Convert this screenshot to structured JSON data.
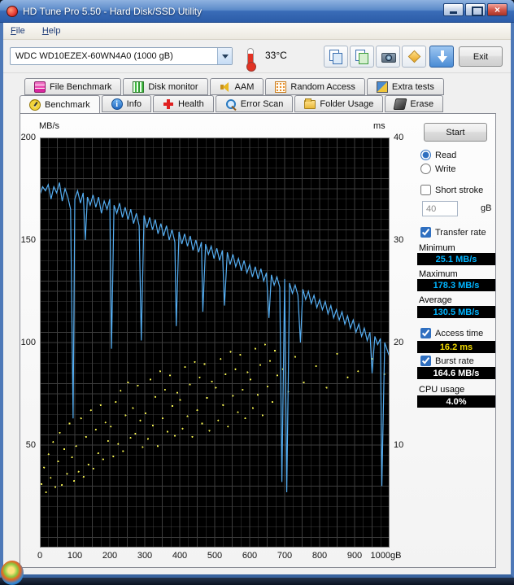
{
  "window": {
    "title": "HD Tune Pro 5.50 - Hard Disk/SSD Utility",
    "close_glyph": "×"
  },
  "menu": {
    "file": "File",
    "help": "Help"
  },
  "toolbar": {
    "drive": "WDC WD10EZEX-60WN4A0 (1000 gB)",
    "temperature": "33°C",
    "exit": "Exit"
  },
  "tabs_row1": [
    {
      "label": "File Benchmark",
      "icon": "file-benchmark-icon"
    },
    {
      "label": "Disk monitor",
      "icon": "disk-monitor-icon"
    },
    {
      "label": "AAM",
      "icon": "aam-icon"
    },
    {
      "label": "Random Access",
      "icon": "random-access-icon"
    },
    {
      "label": "Extra tests",
      "icon": "extra-tests-icon"
    }
  ],
  "tabs_row2": [
    {
      "label": "Benchmark",
      "icon": "benchmark-icon",
      "active": true
    },
    {
      "label": "Info",
      "icon": "info-icon",
      "active": false
    },
    {
      "label": "Health",
      "icon": "health-icon",
      "active": false
    },
    {
      "label": "Error Scan",
      "icon": "error-scan-icon",
      "active": false
    },
    {
      "label": "Folder Usage",
      "icon": "folder-usage-icon",
      "active": false
    },
    {
      "label": "Erase",
      "icon": "erase-icon",
      "active": false
    }
  ],
  "controls": {
    "start": "Start",
    "read": "Read",
    "write": "Write",
    "short_stroke": "Short stroke",
    "short_stroke_value": "40",
    "gb_unit": "gB",
    "transfer_rate": "Transfer rate",
    "minimum": "Minimum",
    "minimum_value": "25.1 MB/s",
    "maximum": "Maximum",
    "maximum_value": "178.3 MB/s",
    "average": "Average",
    "average_value": "130.5 MB/s",
    "access_time": "Access time",
    "access_time_value": "16.2 ms",
    "burst_rate": "Burst rate",
    "burst_rate_value": "164.6 MB/s",
    "cpu_usage": "CPU usage",
    "cpu_usage_value": "4.0%",
    "states": {
      "read": true,
      "write": false,
      "short_stroke": false,
      "transfer_rate": true,
      "access_time": true,
      "burst_rate": true
    }
  },
  "colors": {
    "value_rate": "#00b4ff",
    "value_access": "#f0d800",
    "value_white": "#ffffff",
    "titlebar_blue": "#3a6db8"
  },
  "chart_data": {
    "type": "line+scatter",
    "x_axis": {
      "min": 0,
      "max": 1000,
      "label_suffix": "gB",
      "ticks": [
        0,
        100,
        200,
        300,
        400,
        500,
        600,
        700,
        800,
        900,
        1000
      ],
      "tick_labels": [
        "0",
        "100",
        "200",
        "300",
        "400",
        "500",
        "600",
        "700",
        "800",
        "900",
        "1000gB"
      ]
    },
    "y_left": {
      "label": "MB/s",
      "min": 0,
      "max": 200,
      "ticks": [
        200,
        150,
        100,
        50
      ]
    },
    "y_right": {
      "label": "ms",
      "min": 0,
      "max": 40,
      "ticks": [
        40,
        30,
        20,
        10
      ]
    },
    "grid": {
      "x_step": 25,
      "y_step": 5
    },
    "colors": {
      "bg": "#000000",
      "grid": "#3d3d3d",
      "border": "#8a8a8a",
      "transfer": "#55aef2",
      "access": "#f2ef4e"
    },
    "series": [
      {
        "name": "Transfer rate",
        "type": "line",
        "axis": "left",
        "unit": "MB/s",
        "color_key": "transfer",
        "points": [
          [
            0,
            172
          ],
          [
            8,
            176
          ],
          [
            16,
            174
          ],
          [
            24,
            177
          ],
          [
            32,
            170
          ],
          [
            40,
            176
          ],
          [
            48,
            173
          ],
          [
            56,
            178
          ],
          [
            64,
            169
          ],
          [
            72,
            175
          ],
          [
            80,
            171
          ],
          [
            88,
            165
          ],
          [
            95,
            63
          ],
          [
            100,
            170
          ],
          [
            108,
            174
          ],
          [
            116,
            168
          ],
          [
            124,
            173
          ],
          [
            130,
            150
          ],
          [
            136,
            171
          ],
          [
            144,
            167
          ],
          [
            152,
            172
          ],
          [
            160,
            166
          ],
          [
            168,
            171
          ],
          [
            176,
            163
          ],
          [
            184,
            169
          ],
          [
            192,
            165
          ],
          [
            200,
            170
          ],
          [
            205,
            97
          ],
          [
            212,
            167
          ],
          [
            220,
            163
          ],
          [
            228,
            168
          ],
          [
            236,
            161
          ],
          [
            244,
            166
          ],
          [
            252,
            160
          ],
          [
            260,
            165
          ],
          [
            268,
            158
          ],
          [
            276,
            163
          ],
          [
            284,
            157
          ],
          [
            290,
            101
          ],
          [
            298,
            162
          ],
          [
            306,
            156
          ],
          [
            314,
            161
          ],
          [
            322,
            155
          ],
          [
            330,
            160
          ],
          [
            338,
            153
          ],
          [
            346,
            158
          ],
          [
            354,
            152
          ],
          [
            362,
            157
          ],
          [
            370,
            150
          ],
          [
            378,
            155
          ],
          [
            386,
            149
          ],
          [
            390,
            108
          ],
          [
            398,
            154
          ],
          [
            406,
            148
          ],
          [
            414,
            153
          ],
          [
            422,
            147
          ],
          [
            430,
            152
          ],
          [
            438,
            145
          ],
          [
            446,
            150
          ],
          [
            454,
            144
          ],
          [
            462,
            149
          ],
          [
            466,
            115
          ],
          [
            474,
            148
          ],
          [
            482,
            143
          ],
          [
            490,
            147
          ],
          [
            498,
            141
          ],
          [
            506,
            146
          ],
          [
            514,
            140
          ],
          [
            522,
            145
          ],
          [
            528,
            118
          ],
          [
            536,
            144
          ],
          [
            544,
            138
          ],
          [
            552,
            143
          ],
          [
            560,
            137
          ],
          [
            568,
            141
          ],
          [
            576,
            135
          ],
          [
            584,
            140
          ],
          [
            592,
            134
          ],
          [
            600,
            138
          ],
          [
            608,
            132
          ],
          [
            616,
            137
          ],
          [
            624,
            131
          ],
          [
            632,
            136
          ],
          [
            640,
            130
          ],
          [
            648,
            134
          ],
          [
            655,
            112
          ],
          [
            662,
            133
          ],
          [
            670,
            128
          ],
          [
            678,
            132
          ],
          [
            686,
            127
          ],
          [
            692,
            32
          ],
          [
            700,
            131
          ],
          [
            706,
            27
          ],
          [
            714,
            129
          ],
          [
            722,
            124
          ],
          [
            730,
            128
          ],
          [
            738,
            123
          ],
          [
            745,
            100
          ],
          [
            752,
            126
          ],
          [
            760,
            121
          ],
          [
            768,
            125
          ],
          [
            776,
            119
          ],
          [
            784,
            123
          ],
          [
            792,
            117
          ],
          [
            800,
            121
          ],
          [
            808,
            116
          ],
          [
            816,
            120
          ],
          [
            824,
            114
          ],
          [
            832,
            118
          ],
          [
            840,
            112
          ],
          [
            848,
            116
          ],
          [
            856,
            111
          ],
          [
            864,
            115
          ],
          [
            872,
            109
          ],
          [
            880,
            113
          ],
          [
            888,
            107
          ],
          [
            896,
            111
          ],
          [
            904,
            105
          ],
          [
            912,
            109
          ],
          [
            920,
            103
          ],
          [
            928,
            107
          ],
          [
            936,
            101
          ],
          [
            944,
            105
          ],
          [
            950,
            85
          ],
          [
            958,
            103
          ],
          [
            966,
            99
          ],
          [
            974,
            102
          ],
          [
            978,
            30
          ],
          [
            986,
            100
          ],
          [
            994,
            96
          ],
          [
            1000,
            93
          ]
        ]
      },
      {
        "name": "Access time",
        "type": "scatter",
        "axis": "right",
        "unit": "ms",
        "color_key": "access",
        "points": [
          [
            5,
            6.2
          ],
          [
            12,
            7.8
          ],
          [
            18,
            5.4
          ],
          [
            25,
            9.1
          ],
          [
            31,
            6.8
          ],
          [
            38,
            10.3
          ],
          [
            44,
            5.9
          ],
          [
            52,
            8.4
          ],
          [
            57,
            11.2
          ],
          [
            63,
            6.1
          ],
          [
            70,
            9.6
          ],
          [
            78,
            7.2
          ],
          [
            85,
            12.1
          ],
          [
            92,
            8.8
          ],
          [
            98,
            6.5
          ],
          [
            104,
            9.9
          ],
          [
            111,
            7.4
          ],
          [
            118,
            12.6
          ],
          [
            125,
            6.9
          ],
          [
            132,
            10.8
          ],
          [
            139,
            8.1
          ],
          [
            146,
            13.4
          ],
          [
            153,
            7.7
          ],
          [
            160,
            11.5
          ],
          [
            167,
            9.2
          ],
          [
            174,
            13.9
          ],
          [
            181,
            8.6
          ],
          [
            188,
            12.2
          ],
          [
            195,
            10.4
          ],
          [
            203,
            11.8
          ],
          [
            210,
            8.9
          ],
          [
            217,
            14.2
          ],
          [
            224,
            10.1
          ],
          [
            231,
            15.3
          ],
          [
            238,
            9.4
          ],
          [
            245,
            12.9
          ],
          [
            252,
            16.1
          ],
          [
            259,
            10.7
          ],
          [
            266,
            13.6
          ],
          [
            273,
            11.1
          ],
          [
            280,
            15.8
          ],
          [
            287,
            12.4
          ],
          [
            294,
            9.8
          ],
          [
            302,
            13.1
          ],
          [
            309,
            10.6
          ],
          [
            316,
            16.4
          ],
          [
            323,
            11.9
          ],
          [
            330,
            14.7
          ],
          [
            337,
            9.9
          ],
          [
            344,
            17.2
          ],
          [
            351,
            12.6
          ],
          [
            358,
            15.4
          ],
          [
            365,
            11.3
          ],
          [
            372,
            16.8
          ],
          [
            379,
            13.8
          ],
          [
            386,
            10.9
          ],
          [
            393,
            15.1
          ],
          [
            401,
            14.4
          ],
          [
            408,
            11.6
          ],
          [
            415,
            17.6
          ],
          [
            422,
            12.8
          ],
          [
            429,
            15.9
          ],
          [
            436,
            10.8
          ],
          [
            443,
            18.1
          ],
          [
            450,
            13.4
          ],
          [
            457,
            16.6
          ],
          [
            464,
            12.1
          ],
          [
            471,
            17.9
          ],
          [
            478,
            14.6
          ],
          [
            485,
            11.4
          ],
          [
            492,
            16.2
          ],
          [
            503,
            15.6
          ],
          [
            510,
            12.4
          ],
          [
            517,
            18.4
          ],
          [
            524,
            13.9
          ],
          [
            531,
            16.9
          ],
          [
            538,
            11.8
          ],
          [
            545,
            19.1
          ],
          [
            552,
            14.8
          ],
          [
            559,
            17.4
          ],
          [
            566,
            13.2
          ],
          [
            573,
            18.8
          ],
          [
            580,
            15.4
          ],
          [
            587,
            12.6
          ],
          [
            594,
            17.1
          ],
          [
            602,
            16.4
          ],
          [
            609,
            13.6
          ],
          [
            616,
            19.4
          ],
          [
            623,
            14.9
          ],
          [
            630,
            17.8
          ],
          [
            637,
            12.9
          ],
          [
            644,
            19.8
          ],
          [
            651,
            15.7
          ],
          [
            658,
            18.2
          ],
          [
            665,
            14.2
          ],
          [
            672,
            19.2
          ],
          [
            679,
            16.8
          ],
          [
            695,
            17.4
          ],
          [
            710,
            15.2
          ],
          [
            730,
            18.6
          ],
          [
            755,
            16.1
          ],
          [
            790,
            17.7
          ],
          [
            820,
            15.6
          ],
          [
            850,
            18.9
          ],
          [
            880,
            16.6
          ],
          [
            910,
            17.2
          ],
          [
            950,
            18.4
          ],
          [
            985,
            16.9
          ]
        ]
      }
    ]
  }
}
